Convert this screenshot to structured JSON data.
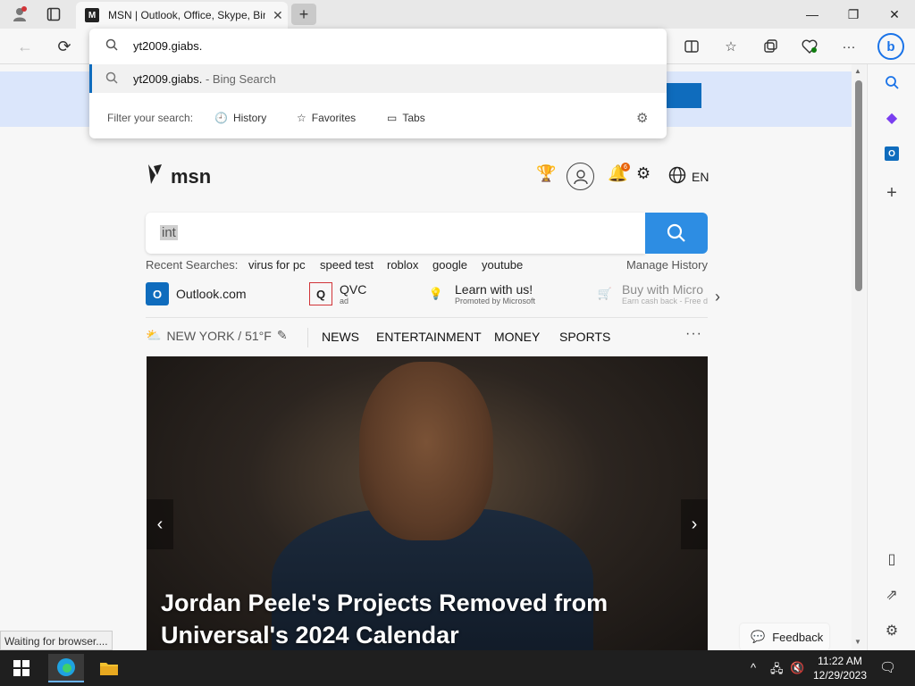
{
  "browser": {
    "tab_title": "MSN | Outlook, Office, Skype, Bing",
    "tab_favicon_letter": "M",
    "newtab_symbol": "+"
  },
  "omnibox": {
    "input_value": "yt2009.giabs.",
    "suggestion_main": "yt2009.giabs.",
    "suggestion_suffix": " - Bing Search",
    "filter_label": "Filter your search:",
    "filters": [
      "History",
      "Favorites",
      "Tabs"
    ]
  },
  "msn": {
    "logo_text": "msn",
    "notification_count": "6",
    "language": "EN",
    "search_value": "int",
    "recent_label": "Recent Searches:",
    "recent_items": [
      "virus for pc",
      "speed test",
      "roblox",
      "google",
      "youtube"
    ],
    "manage_history": "Manage History",
    "shortcuts": [
      {
        "title": "Outlook.com",
        "sub": ""
      },
      {
        "title": "QVC",
        "sub": "ad"
      },
      {
        "title": "Learn with us!",
        "sub": "Promoted by Microsoft"
      },
      {
        "title": "Buy with Micro",
        "sub": "Earn cash back - Free d"
      }
    ],
    "weather": "NEW YORK / 51°F",
    "nav": [
      "NEWS",
      "ENTERTAINMENT",
      "MONEY",
      "SPORTS"
    ],
    "headline": "Jordan Peele's Projects Removed from Universal's 2024 Calendar",
    "feedback": "Feedback"
  },
  "status_text": "Waiting for browser....",
  "clock": {
    "time": "11:22 AM",
    "date": "12/29/2023"
  },
  "colors": {
    "accent": "#0f6cbd",
    "search_button": "#2d8de3",
    "taskbar": "#1f1f1f"
  }
}
